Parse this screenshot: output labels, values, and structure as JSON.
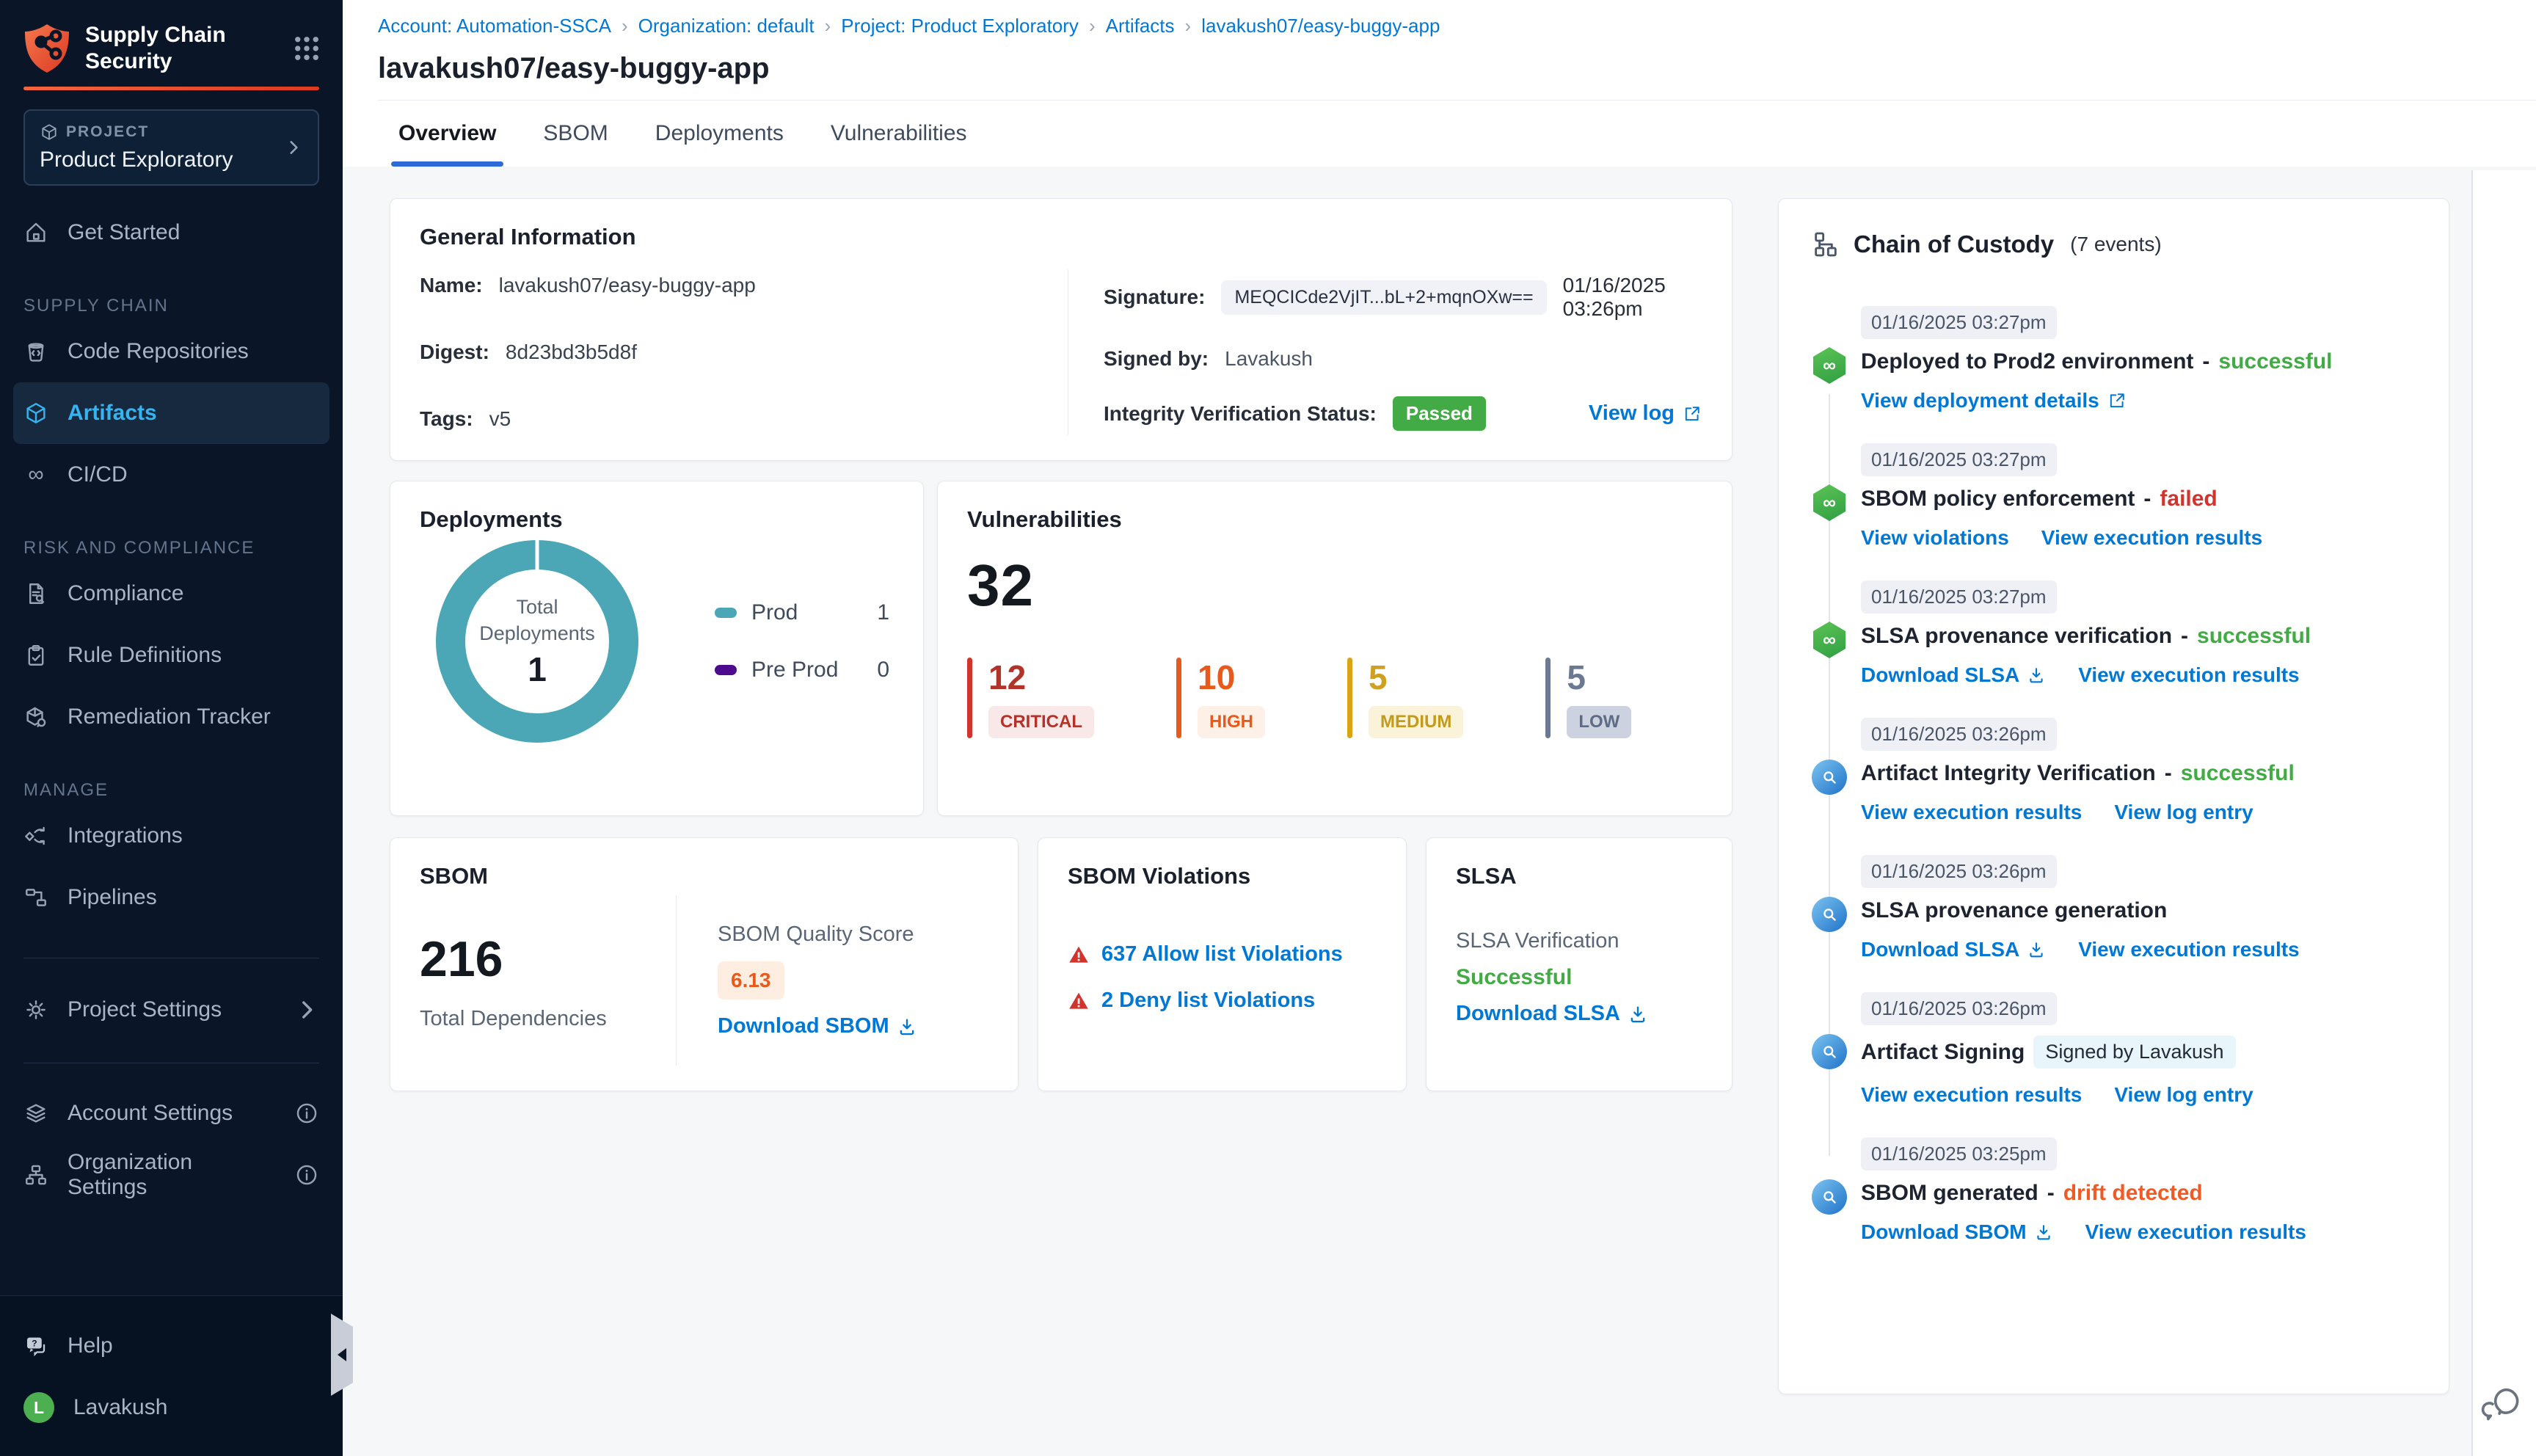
{
  "sidebar": {
    "app_title": "Supply Chain Security",
    "project_label": "PROJECT",
    "project_name": "Product Exploratory",
    "items": [
      {
        "label": "Get Started"
      },
      {
        "label": "SUPPLY CHAIN"
      },
      {
        "label": "Code Repositories"
      },
      {
        "label": "Artifacts"
      },
      {
        "label": "CI/CD"
      },
      {
        "label": "RISK AND COMPLIANCE"
      },
      {
        "label": "Compliance"
      },
      {
        "label": "Rule Definitions"
      },
      {
        "label": "Remediation Tracker"
      },
      {
        "label": "MANAGE"
      },
      {
        "label": "Integrations"
      },
      {
        "label": "Pipelines"
      },
      {
        "label": "Project Settings"
      },
      {
        "label": "Account Settings"
      },
      {
        "label": "Organization Settings"
      },
      {
        "label": "Help"
      },
      {
        "label": "Lavakush"
      }
    ],
    "avatar_initial": "L"
  },
  "breadcrumb": {
    "items": [
      {
        "label": "Account: Automation-SSCA"
      },
      {
        "label": "Organization: default"
      },
      {
        "label": "Project: Product Exploratory"
      },
      {
        "label": "Artifacts"
      },
      {
        "label": "lavakush07/easy-buggy-app"
      }
    ]
  },
  "page": {
    "title": "lavakush07/easy-buggy-app",
    "tabs": [
      {
        "label": "Overview"
      },
      {
        "label": "SBOM"
      },
      {
        "label": "Deployments"
      },
      {
        "label": "Vulnerabilities"
      }
    ]
  },
  "general_info": {
    "title": "General Information",
    "name_label": "Name:",
    "name": "lavakush07/easy-buggy-app",
    "digest_label": "Digest:",
    "digest": "8d23bd3b5d8f",
    "tags_label": "Tags:",
    "tags": "v5",
    "signature_label": "Signature:",
    "signature": "MEQCICde2VjIT...bL+2+mqnOXw==",
    "signature_time": "01/16/2025 03:26pm",
    "signed_by_label": "Signed by:",
    "signed_by": "Lavakush",
    "integrity_label": "Integrity Verification Status:",
    "integrity_status": "Passed",
    "view_log": "View log"
  },
  "deployments": {
    "title": "Deployments",
    "center_label": "Total Deployments",
    "total": "1",
    "legend": [
      {
        "label": "Prod",
        "value": "1",
        "color": "#4ba7b5"
      },
      {
        "label": "Pre Prod",
        "value": "0",
        "color": "#4d0b8e"
      }
    ]
  },
  "chart_data": {
    "type": "pie",
    "title": "Deployments",
    "categories": [
      "Prod",
      "Pre Prod"
    ],
    "values": [
      1,
      0
    ],
    "center_label": "Total Deployments",
    "center_value": 1,
    "colors": [
      "#4ba7b5",
      "#4d0b8e"
    ]
  },
  "vulnerabilities": {
    "title": "Vulnerabilities",
    "total": "32",
    "severities": [
      {
        "count": "12",
        "label": "CRITICAL",
        "color": "#b3332a"
      },
      {
        "count": "10",
        "label": "HIGH",
        "color": "#e8591c"
      },
      {
        "count": "5",
        "label": "MEDIUM",
        "color": "#d9a514"
      },
      {
        "count": "5",
        "label": "LOW",
        "color": "#6b7992"
      }
    ]
  },
  "sbom": {
    "title": "SBOM",
    "total": "216",
    "total_label": "Total Dependencies",
    "quality_label": "SBOM Quality Score",
    "quality_score": "6.13",
    "download": "Download SBOM"
  },
  "sbom_violations": {
    "title": "SBOM Violations",
    "items": [
      {
        "label": "637 Allow list Violations"
      },
      {
        "label": "2 Deny list Violations"
      }
    ]
  },
  "slsa": {
    "title": "SLSA",
    "verification_label": "SLSA Verification",
    "status": "Successful",
    "download": "Download SLSA"
  },
  "chain": {
    "title": "Chain of Custody",
    "events_count": "(7 events)",
    "events": [
      {
        "time": "01/16/2025 03:27pm",
        "title": "Deployed to Prod2 environment",
        "sep": "-",
        "status": "successful",
        "links": [
          {
            "label": "View deployment details"
          }
        ]
      },
      {
        "time": "01/16/2025 03:27pm",
        "title": "SBOM policy enforcement",
        "sep": "-",
        "status": "failed",
        "links": [
          {
            "label": "View violations"
          },
          {
            "label": "View execution results"
          }
        ]
      },
      {
        "time": "01/16/2025 03:27pm",
        "title": "SLSA provenance verification",
        "sep": "-",
        "status": "successful",
        "links": [
          {
            "label": "Download SLSA"
          },
          {
            "label": "View execution results"
          }
        ]
      },
      {
        "time": "01/16/2025 03:26pm",
        "title": "Artifact Integrity Verification",
        "sep": "-",
        "status": "successful",
        "links": [
          {
            "label": "View execution results"
          },
          {
            "label": "View log entry"
          }
        ]
      },
      {
        "time": "01/16/2025 03:26pm",
        "title": "SLSA provenance generation",
        "links": [
          {
            "label": "Download SLSA"
          },
          {
            "label": "View execution results"
          }
        ]
      },
      {
        "time": "01/16/2025 03:26pm",
        "title": "Artifact Signing",
        "badge": "Signed by Lavakush",
        "links": [
          {
            "label": "View execution results"
          },
          {
            "label": "View log entry"
          }
        ]
      },
      {
        "time": "01/16/2025 03:25pm",
        "title": "SBOM generated",
        "sep": "-",
        "status": "drift detected",
        "links": [
          {
            "label": "Download SBOM"
          },
          {
            "label": "View execution results"
          }
        ]
      }
    ]
  },
  "colors": {
    "accent_red": "#e4452e",
    "link_blue": "#0278d5",
    "tab_blue": "#2f6bd8",
    "success_green": "#42ab45",
    "failed_red": "#d0342c",
    "drift_orange": "#e8591c",
    "sidebar_active_blue": "#36b4ef",
    "passed_badge_green": "#42ab45"
  }
}
